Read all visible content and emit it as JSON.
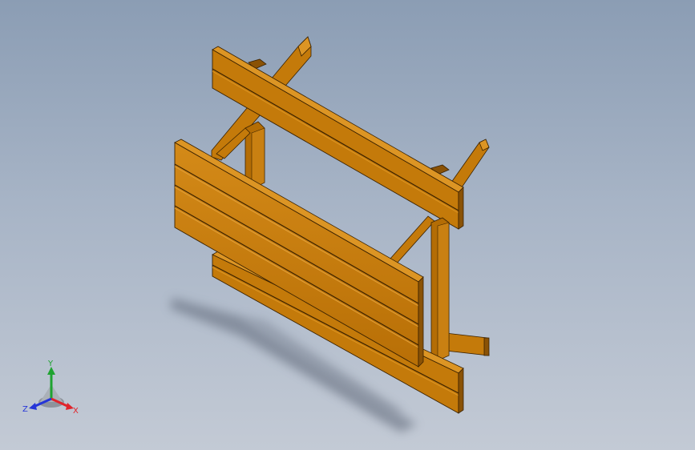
{
  "triad": {
    "x_label": "X",
    "y_label": "Y",
    "z_label": "Z",
    "x_color": "#e0242b",
    "y_color": "#1fa331",
    "z_color": "#2535d8"
  },
  "model": {
    "wood_color": "#c47a0a",
    "wood_dark": "#8a5205",
    "wood_light": "#dc9524",
    "shadow_color": "#6e7886"
  }
}
